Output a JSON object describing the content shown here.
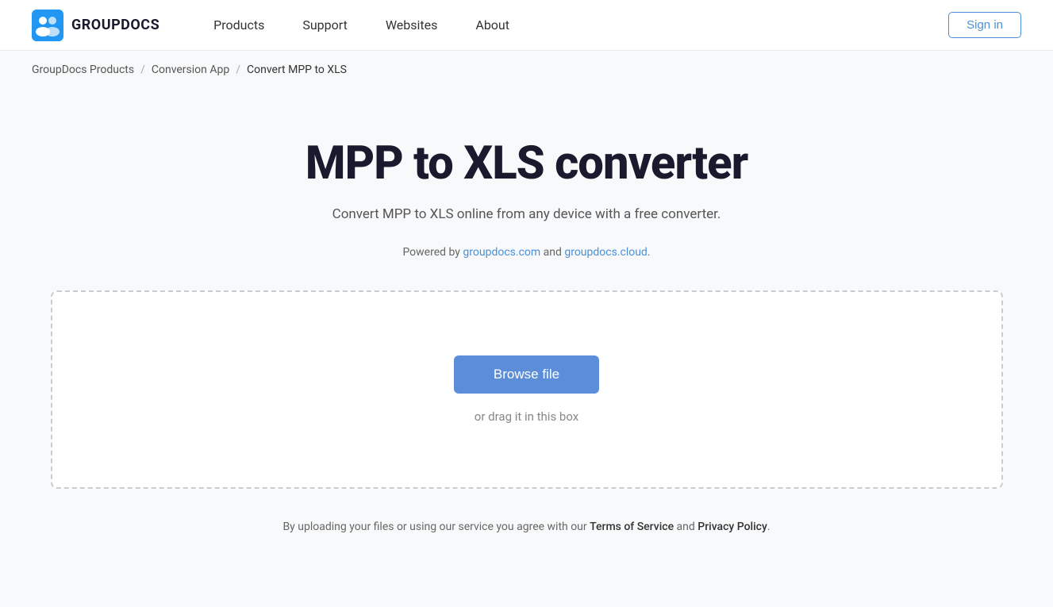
{
  "header": {
    "logo_text": "GROUPDOCS",
    "nav": {
      "products": "Products",
      "support": "Support",
      "websites": "Websites",
      "about": "About"
    },
    "sign_in": "Sign in"
  },
  "breadcrumb": {
    "item1": "GroupDocs Products",
    "separator1": "/",
    "item2": "Conversion App",
    "separator2": "/",
    "item3": "Convert MPP to XLS"
  },
  "main": {
    "title": "MPP to XLS converter",
    "subtitle": "Convert MPP to XLS online from any device with a free converter.",
    "powered_by_prefix": "Powered by ",
    "powered_by_link1": "groupdocs.com",
    "powered_by_middle": " and ",
    "powered_by_link2": "groupdocs.cloud",
    "powered_by_suffix": ".",
    "browse_file": "Browse file",
    "drag_text": "or drag it in this box"
  },
  "footer": {
    "note_prefix": "By uploading your files or using our service you agree with our ",
    "tos_link": "Terms of Service",
    "note_middle": " and ",
    "privacy_link": "Privacy Policy",
    "note_suffix": "."
  }
}
